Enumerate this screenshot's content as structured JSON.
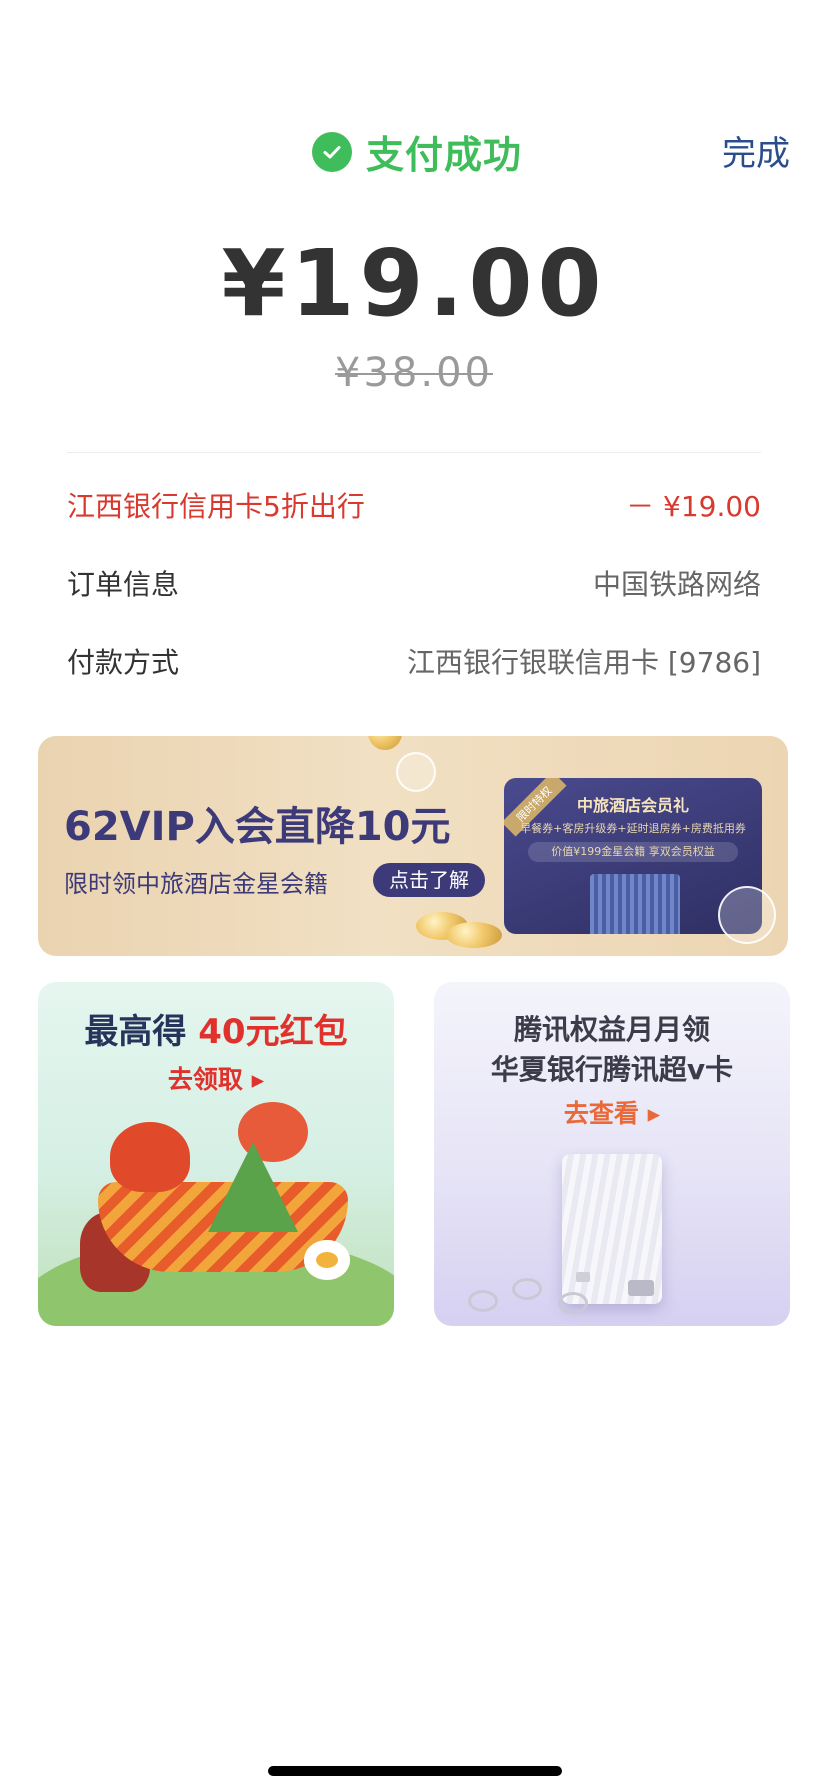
{
  "status": {
    "icon": "check-circle-icon",
    "text": "支付成功",
    "color": "#3fbd5b"
  },
  "done_label": "完成",
  "amount": "¥19.00",
  "original_amount": "¥38.00",
  "rows": {
    "discount": {
      "label": "江西银行信用卡5折出行",
      "value": "－ ¥19.00",
      "color": "#d9392e"
    },
    "order": {
      "label": "订单信息",
      "value": "中国铁路网络"
    },
    "payment": {
      "label": "付款方式",
      "value": "江西银行银联信用卡 [9786]"
    }
  },
  "banner": {
    "title": "62VIP入会直降10元",
    "subtitle": "限时领中旅酒店金星会籍",
    "cta": "点击了解",
    "card": {
      "tag": "限时特权",
      "title": "中旅酒店会员礼",
      "benefits": "早餐券+客房升级券+延时退房券+房费抵用券",
      "value_line": "价值¥199金星会籍 享双会员权益"
    }
  },
  "promo_left": {
    "title_prefix": "最高得",
    "title_highlight": "40元红包",
    "link": "去领取 ▸"
  },
  "promo_right": {
    "title_line1": "腾讯权益月月领",
    "title_line2": "华夏银行腾讯超v卡",
    "link": "去查看 ▸"
  }
}
